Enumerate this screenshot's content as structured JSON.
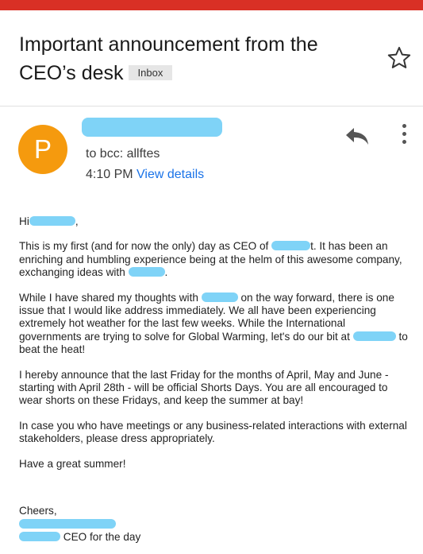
{
  "header": {
    "subject": "Important announcement from the CEO’s desk",
    "label": "Inbox",
    "star_icon": "star-outline-icon"
  },
  "sender": {
    "avatar_letter": "P",
    "avatar_color": "#f59a0e",
    "to_line": "to bcc: allftes",
    "time": "4:10 PM",
    "view_details": "View details",
    "reply_icon": "reply-icon",
    "more_icon": "more-vert-icon"
  },
  "message": {
    "greeting_start": "Hi",
    "greeting_end": ",",
    "p1_a": "This is my first (and for now the only) day as CEO of ",
    "p1_b": "t. It has been an enriching and humbling experience being at the helm of this awesome company, exchanging ideas with ",
    "p1_c": ".",
    "p2_a": "While I have shared my thoughts with ",
    "p2_b": " on the way forward, there is one issue that I would like address immediately. We all have been experiencing extremely hot weather for the last few weeks. While the International governments are trying to solve for Global Warming, let's do our bit at ",
    "p2_c": " to beat the heat!",
    "p3": "I hereby announce that the last Friday for the months of April, May and June - starting with April 28th - will be official Shorts Days. You are all encouraged to wear shorts on these Fridays, and keep the summer at bay!",
    "p4": "In case you who have meetings or any business-related interactions with external stakeholders, please dress appropriately.",
    "p5": "Have a great summer!",
    "closing": "Cheers,",
    "title": " CEO for the day"
  },
  "colors": {
    "top_bar": "#d93025",
    "link": "#1a73e8",
    "redaction": "#7fd3f7"
  }
}
